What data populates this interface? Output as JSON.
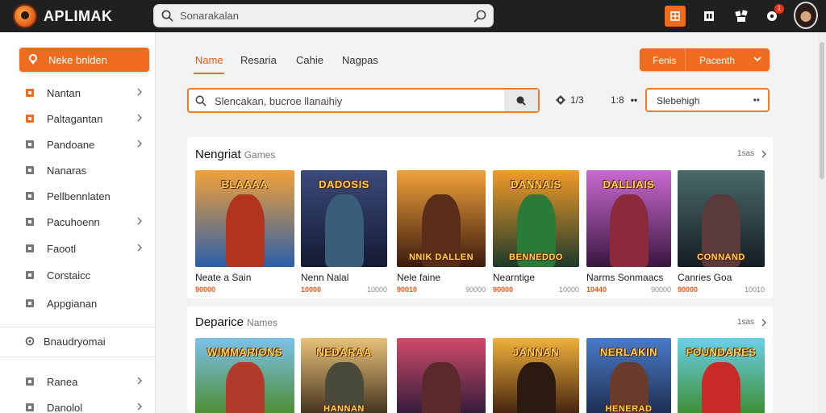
{
  "app": {
    "title": "APLIMAK"
  },
  "top_search": {
    "placeholder": "Sonarakalan"
  },
  "notifications": {
    "count": "1"
  },
  "sidebar": {
    "cta_label": "Neke bnlden",
    "items": [
      {
        "label": "Nantan",
        "icon": "pencil-icon",
        "color": "#ef6c1e",
        "chevron": true
      },
      {
        "label": "Paltagantan",
        "icon": "wrench-icon",
        "color": "#ef6c1e",
        "chevron": true
      },
      {
        "label": "Pandoane",
        "icon": "box-icon",
        "color": "#777777",
        "chevron": true
      },
      {
        "label": "Nanaras",
        "icon": "box-icon",
        "color": "#777777",
        "chevron": false
      },
      {
        "label": "Pellbennlaten",
        "icon": "square-icon",
        "color": "#777777",
        "chevron": false
      },
      {
        "label": "Pacuhoenn",
        "icon": "hammer-icon",
        "color": "#777777",
        "chevron": true
      },
      {
        "label": "Faootl",
        "icon": "home-icon",
        "color": "#777777",
        "chevron": true
      },
      {
        "label": "Corstaicc",
        "icon": "tag-icon",
        "color": "#777777",
        "chevron": false
      },
      {
        "label": "Appgianan",
        "icon": "tray-icon",
        "color": "#777777",
        "chevron": false
      }
    ],
    "section_label": "Bnaudryomai",
    "bottom_items": [
      {
        "label": "Ranea",
        "chevron": true
      },
      {
        "label": "Danolol",
        "chevron": true
      }
    ]
  },
  "tabs": [
    {
      "label": "Name",
      "active": true
    },
    {
      "label": "Resaria",
      "active": false
    },
    {
      "label": "Cahie",
      "active": false
    },
    {
      "label": "Nagpas",
      "active": false
    }
  ],
  "split_button": {
    "left": "Fenis",
    "right": "Pacenth"
  },
  "main_search": {
    "value": "Slencakan, bucroe llanaihiy"
  },
  "filters": {
    "a": "1/3",
    "b": "1:8"
  },
  "sort_select": {
    "value": "Slebehigh"
  },
  "sections": [
    {
      "title": "Nengriat",
      "subtitle": "Games",
      "more": "1sas",
      "games": [
        {
          "title": "Neate a Sain",
          "rating": "90000",
          "count": "",
          "thumb": "BLAAAA",
          "bg1": "#f2a13a",
          "bg2": "#2a5fa8",
          "char": "#b2341e",
          "caption": ""
        },
        {
          "title": "Nenn Nalal",
          "rating": "10000",
          "count": "10000",
          "thumb": "DADOSIS",
          "bg1": "#3b4a7a",
          "bg2": "#131a33",
          "char": "#3a5d7a",
          "caption": ""
        },
        {
          "title": "Nele faine",
          "rating": "90010",
          "count": "90000",
          "thumb": "",
          "bg1": "#f0a13a",
          "bg2": "#3a1a0e",
          "char": "#5a2d18",
          "caption": "NNIK DALLEN"
        },
        {
          "title": "Nearntige",
          "rating": "90000",
          "count": "10000",
          "thumb": "DANNAIS",
          "bg1": "#f29b2a",
          "bg2": "#1d3a2a",
          "char": "#2a7a3a",
          "caption": "BENNEDDO"
        },
        {
          "title": "Narms Sonmaacs",
          "rating": "10440",
          "count": "90000",
          "thumb": "DALLIAIS",
          "bg1": "#c86ad0",
          "bg2": "#3a1640",
          "char": "#8a2a3a",
          "caption": ""
        },
        {
          "title": "Canries Goa",
          "rating": "90000",
          "count": "10010",
          "thumb": "",
          "bg1": "#4a6a6a",
          "bg2": "#141c22",
          "char": "#5a3a3a",
          "caption": "CONNAND"
        }
      ]
    },
    {
      "title": "Deparice",
      "subtitle": "Names",
      "more": "1sas",
      "games": [
        {
          "title": "",
          "rating": "",
          "count": "",
          "thumb": "WIMMARIONS",
          "bg1": "#7ec1e8",
          "bg2": "#4a8a2a",
          "char": "#b23a2a",
          "caption": ""
        },
        {
          "title": "",
          "rating": "",
          "count": "",
          "thumb": "NEDARAA",
          "bg1": "#e8c27a",
          "bg2": "#3a2a1a",
          "char": "#4a4a3a",
          "caption": "HANNAN"
        },
        {
          "title": "",
          "rating": "",
          "count": "",
          "thumb": "",
          "bg1": "#d04a6a",
          "bg2": "#2a1a3a",
          "char": "#5a2a2a",
          "caption": ""
        },
        {
          "title": "",
          "rating": "",
          "count": "",
          "thumb": "JANNAN",
          "bg1": "#f0b23a",
          "bg2": "#3a1a0e",
          "char": "#2a1a10",
          "caption": ""
        },
        {
          "title": "",
          "rating": "",
          "count": "",
          "thumb": "NERLAKIN",
          "bg1": "#4a7ac8",
          "bg2": "#1a2a4a",
          "char": "#6a3a2a",
          "caption": "HENERAD"
        },
        {
          "title": "",
          "rating": "",
          "count": "",
          "thumb": "FOUNDARES",
          "bg1": "#6ad0e8",
          "bg2": "#3a8a2a",
          "char": "#c82a2a",
          "caption": ""
        }
      ]
    }
  ],
  "colors": {
    "accent": "#ef6c1e",
    "topbar": "#202020"
  }
}
